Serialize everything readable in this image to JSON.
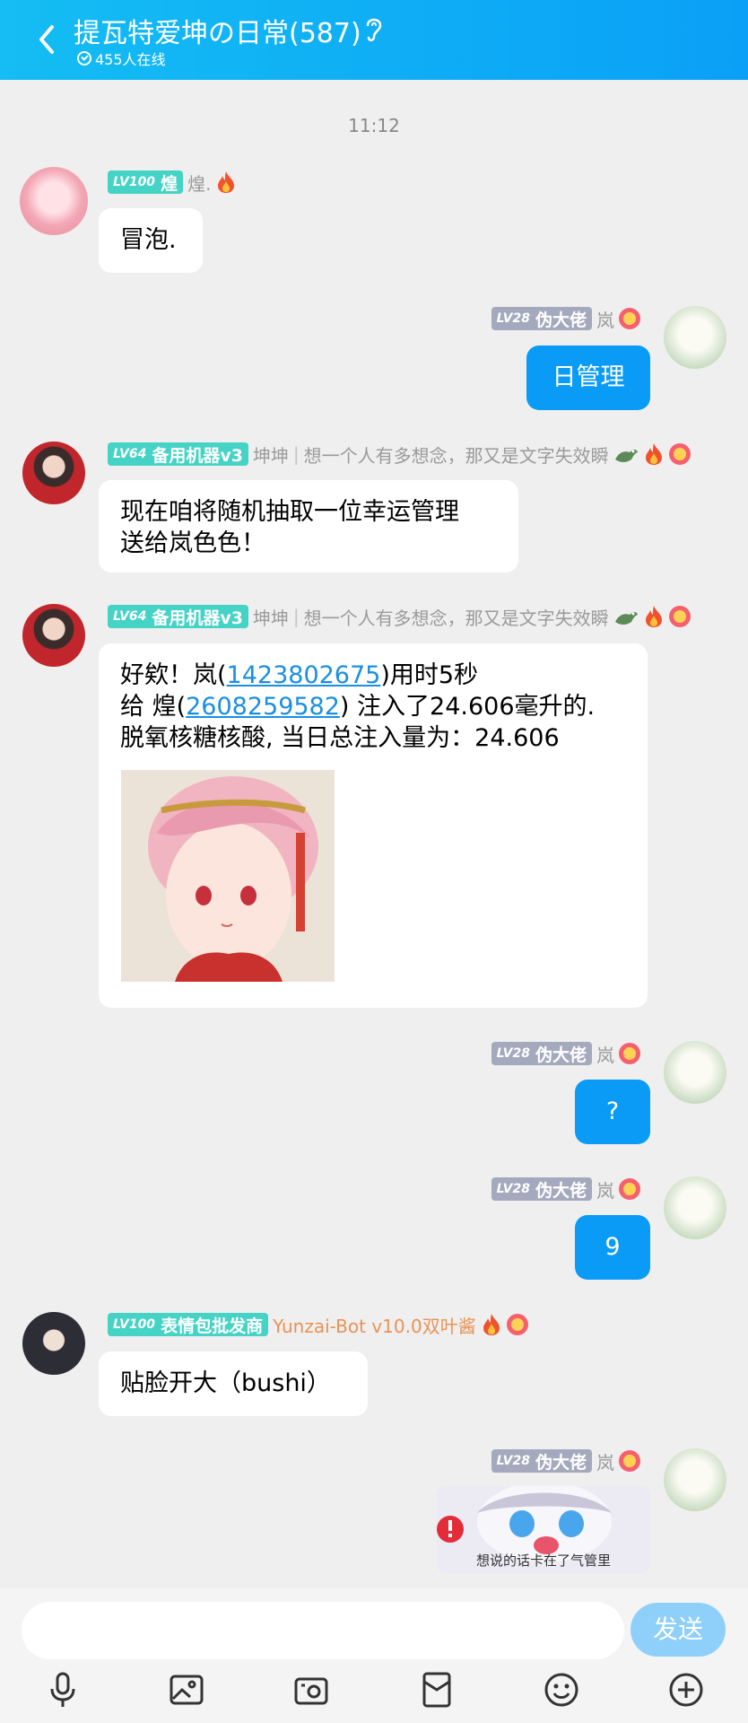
{
  "header": {
    "title": "提瓦特爱坤の日常(587)",
    "online": "455人在线"
  },
  "time": "11:12",
  "messages": [
    {
      "side": "left",
      "level_num": "LV100",
      "level_title": "煌",
      "name": "煌.",
      "text": "冒泡."
    },
    {
      "side": "right",
      "level_num": "LV28",
      "level_title": "伪大佬",
      "name": "岚",
      "text": "日管理"
    },
    {
      "side": "left",
      "level_num": "LV64",
      "level_title": "备用机器v3",
      "name": "坤坤",
      "sep": "|",
      "signature": "想一个人有多想念，那又是文字失效瞬",
      "text_line1": "现在咱将随机抽取一位幸运管理",
      "text_line2": "送给岚色色！"
    },
    {
      "side": "left",
      "level_num": "LV64",
      "level_title": "备用机器v3",
      "name": "坤坤",
      "sep": "|",
      "signature": "想一个人有多想念，那又是文字失效瞬",
      "l1a": "好欸！岚(",
      "l1b": "1423802675",
      "l1c": ")用时5秒",
      "l2a": "给 煌(",
      "l2b": "2608259582",
      "l2c": ") 注入了24.606毫升的.",
      "l3": "脱氧核糖核酸, 当日总注入量为：24.606"
    },
    {
      "side": "right",
      "level_num": "LV28",
      "level_title": "伪大佬",
      "name": "岚",
      "text": "?"
    },
    {
      "side": "right",
      "level_num": "LV28",
      "level_title": "伪大佬",
      "name": "岚",
      "text": "9"
    },
    {
      "side": "left",
      "level_num": "LV100",
      "level_title": "表情包批发商",
      "name": "Yunzai-Bot v10.0双叶酱",
      "text": "贴脸开大（bushi）"
    },
    {
      "side": "right",
      "level_num": "LV28",
      "level_title": "伪大佬",
      "name": "岚",
      "sticker_caption": "想说的话卡在了气管里"
    }
  ],
  "send_label": "发送",
  "colors": {
    "header": "#0aa0f7",
    "bubble_blue": "#0a9bf6",
    "level_teal": "#45d3c6",
    "level_grey": "#a4a9bd",
    "send": "#8ed0f9"
  }
}
